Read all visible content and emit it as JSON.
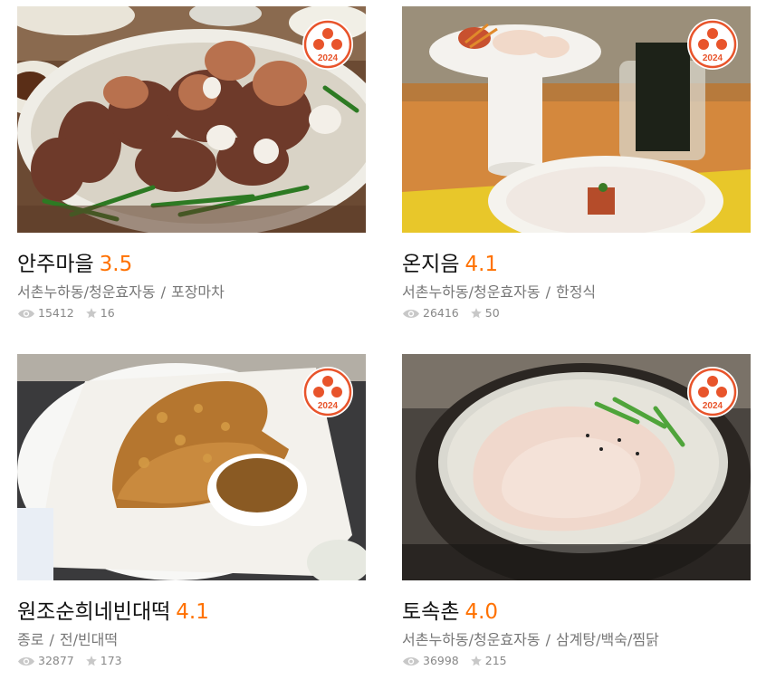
{
  "badge_year": "2024",
  "colors": {
    "score": "#ff7100",
    "badge": "#e8542b"
  },
  "restaurants": [
    {
      "name": "안주마을",
      "score": "3.5",
      "area": "서촌누하동/청운효자동",
      "category": "포장마차",
      "views": "15412",
      "favorites": "16"
    },
    {
      "name": "온지음",
      "score": "4.1",
      "area": "서촌누하동/청운효자동",
      "category": "한정식",
      "views": "26416",
      "favorites": "50"
    },
    {
      "name": "원조순희네빈대떡",
      "score": "4.1",
      "area": "종로",
      "category": "전/빈대떡",
      "views": "32877",
      "favorites": "173"
    },
    {
      "name": "토속촌",
      "score": "4.0",
      "area": "서촌누하동/청운효자동",
      "category": "삼계탕/백숙/찜닭",
      "views": "36998",
      "favorites": "215"
    }
  ],
  "separator": "/"
}
